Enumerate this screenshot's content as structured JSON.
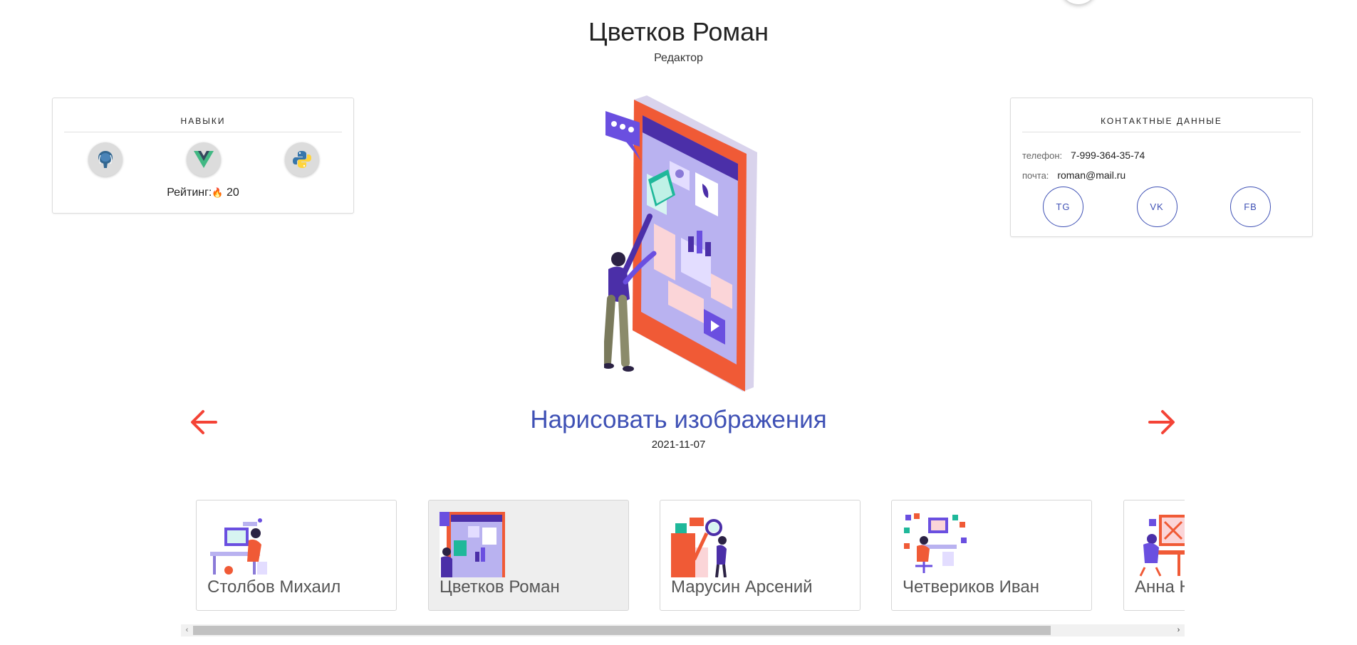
{
  "profile": {
    "name": "Цветков Роман",
    "role": "Редактор"
  },
  "skills": {
    "title": "НАВЫКИ",
    "items": [
      {
        "icon": "postgresql-icon"
      },
      {
        "icon": "vue-icon"
      },
      {
        "icon": "python-icon"
      }
    ],
    "rating_label": "Рейтинг:",
    "rating_value": "20"
  },
  "contacts": {
    "title": "КОНТАКТНЫЕ ДАННЫЕ",
    "phone_label": "телефон:",
    "phone": "7-999-364-35-74",
    "email_label": "почта:",
    "email": "roman@mail.ru",
    "social": [
      "TG",
      "VK",
      "FB"
    ]
  },
  "task": {
    "title": "Нарисовать изображения",
    "date": "2021-11-07"
  },
  "carousel": {
    "people": [
      {
        "name": "Столбов Михаил",
        "active": false
      },
      {
        "name": "Цветков Роман",
        "active": true
      },
      {
        "name": "Марусин Арсений",
        "active": false
      },
      {
        "name": "Четвериков Иван",
        "active": false
      },
      {
        "name": "Анна Ни",
        "active": false
      }
    ]
  },
  "colors": {
    "accent": "#3f51b5",
    "arrow": "#f44336",
    "active_card": "#eeeeee"
  }
}
